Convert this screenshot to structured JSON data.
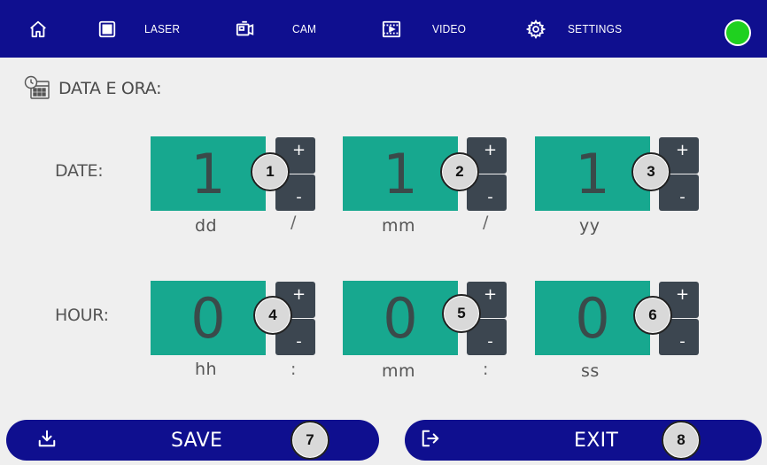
{
  "nav": {
    "home_icon": "home-icon",
    "grid_icon": "grid-icon",
    "laser_label": "LASER",
    "cam_label": "CAM",
    "video_label": "VIDEO",
    "settings_label": "SETTINGS",
    "status_color": "#1fd11f"
  },
  "section": {
    "title": "DATA E ORA:",
    "icon": "calendar-clock-icon"
  },
  "date_row": {
    "label": "DATE:",
    "fields": [
      {
        "value": "1",
        "unit": "dd",
        "badge": "1"
      },
      {
        "value": "1",
        "unit": "mm",
        "badge": "2"
      },
      {
        "value": "1",
        "unit": "yy",
        "badge": "3"
      }
    ],
    "separators": [
      "/",
      "/"
    ]
  },
  "hour_row": {
    "label": "HOUR:",
    "fields": [
      {
        "value": "0",
        "unit": "hh",
        "badge": "4"
      },
      {
        "value": "0",
        "unit": "mm",
        "badge": "5"
      },
      {
        "value": "0",
        "unit": "ss",
        "badge": "6"
      }
    ],
    "separators": [
      ":",
      ":"
    ]
  },
  "stepper": {
    "plus": "+",
    "minus": "-"
  },
  "actions": {
    "save_label": "SAVE",
    "save_badge": "7",
    "exit_label": "EXIT",
    "exit_badge": "8"
  },
  "colors": {
    "bar": "#0f0f8f",
    "value_box": "#17a88f",
    "stepper": "#3c4650",
    "background": "#efefef"
  }
}
